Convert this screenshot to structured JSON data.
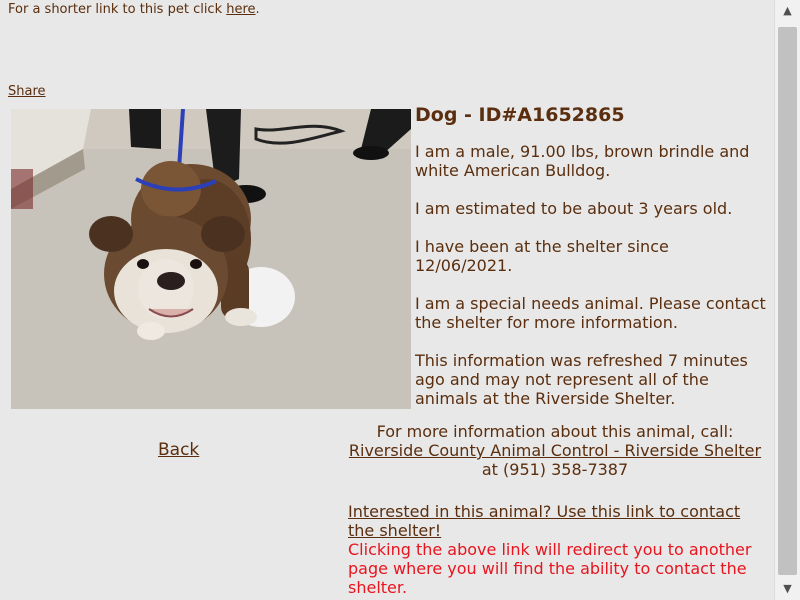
{
  "header": {
    "short_link_prefix": "For a shorter link to this pet click ",
    "short_link_label": "here",
    "short_link_suffix": ".",
    "share_label": "Share"
  },
  "pet": {
    "title": "Dog - ID#A1652865",
    "description": "I am a male, 91.00 lbs, brown brindle and white American Bulldog.",
    "age": "I am estimated to be about 3 years old.",
    "shelter_since": "I have been at the shelter since 12/06/2021.",
    "special_needs": "I am a special needs animal. Please contact the shelter for more information.",
    "refresh_note": "This information was refreshed 7 minutes ago and may not represent all of the animals at the Riverside Shelter."
  },
  "nav": {
    "back_label": "Back"
  },
  "contact": {
    "more_info": "For more information about this animal, call:",
    "shelter_name": "Riverside County Animal Control - Riverside Shelter",
    "phone_prefix": " at ",
    "phone": "(951) 358-7387",
    "interest_link": "Interested in this animal? Use this link to contact the shelter!",
    "redirect_note": "Clicking the above link will redirect you to another page where you will find the ability to contact the shelter."
  },
  "colors": {
    "text": "#5a2e0e",
    "warning": "#e8141e",
    "background": "#e8e8e8"
  }
}
